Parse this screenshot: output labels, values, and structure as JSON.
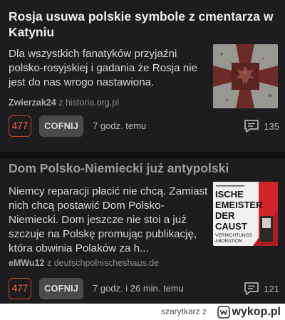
{
  "posts": [
    {
      "title": "Rosja usuwa polskie symbole z cmentarza w Katyniu",
      "body": "Dla wszystkich fanatyków przyjaźni polsko-rosyjskiej i gadania że Rosja nie jest do nas wrogo nastawiona.",
      "author": "Zwierzak24",
      "source_prefix": "z",
      "source": "historia.org.pl",
      "votes": "477",
      "undo_label": "COFNIJ",
      "time": "7 godz. temu",
      "comments": "135",
      "thumbnail_icon": "memorial-cross-image"
    },
    {
      "title": "Dom Polsko-Niemiecki już antypolski",
      "body": "Niemcy reparacji płacić nie chcą. Zamiast nich chcą postawić Dom Polsko-Niemiecki. Dom jeszcze nie stoi a już szczuje na Polskę promując publikację, która obwinia Polaków za h...",
      "author": "eMWu12",
      "source_prefix": "z",
      "source": "deutschpolnischeshaus.de",
      "votes": "477",
      "undo_label": "COFNIJ",
      "time": "7 godz. i 26 min. temu",
      "comments": "121",
      "thumbnail_text": [
        "ISCHE",
        "EMEISTER",
        "DER",
        "CAUST",
        "VERNICHTUNGS",
        "ABORATION"
      ],
      "thumbnail_icon": "book-cover-image"
    }
  ],
  "footer": {
    "user": "szarytkarz",
    "user_suffix": "z",
    "logo_text": "wykop.pl",
    "logo_icon": "wykop-logo-icon"
  },
  "colors": {
    "background": "#1d1d1f",
    "vote_accent": "#ff6a45",
    "button_bg": "#4a4a4c"
  }
}
